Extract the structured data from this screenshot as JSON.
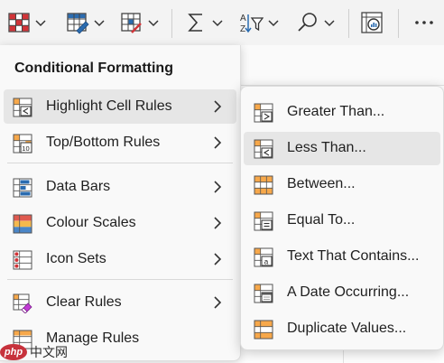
{
  "toolbar": {
    "buttons": [
      {
        "icon": "conditional-formatting-icon",
        "has_menu": true
      },
      {
        "icon": "format-as-table-icon",
        "has_menu": true
      },
      {
        "icon": "cell-styles-icon",
        "has_menu": true
      },
      {
        "icon": "autosum-icon",
        "has_menu": true
      },
      {
        "icon": "sort-filter-icon",
        "has_menu": true
      },
      {
        "icon": "find-icon",
        "has_menu": true
      },
      {
        "icon": "analyze-data-icon",
        "has_menu": false
      },
      {
        "icon": "more-options-icon",
        "has_menu": false
      }
    ]
  },
  "menu": {
    "title": "Conditional Formatting",
    "items": [
      {
        "label": "Highlight Cell Rules",
        "icon": "highlight-cell-rules-icon",
        "submenu": true,
        "active": true
      },
      {
        "label": "Top/Bottom Rules",
        "icon": "top-bottom-rules-icon",
        "submenu": true
      },
      {
        "label": "Data Bars",
        "icon": "data-bars-icon",
        "submenu": true
      },
      {
        "label": "Colour Scales",
        "icon": "colour-scales-icon",
        "submenu": true
      },
      {
        "label": "Icon Sets",
        "icon": "icon-sets-icon",
        "submenu": true
      },
      {
        "label": "Clear Rules",
        "icon": "clear-rules-icon",
        "submenu": true
      },
      {
        "label": "Manage Rules",
        "icon": "manage-rules-icon",
        "submenu": false
      }
    ]
  },
  "submenu": {
    "items": [
      {
        "label": "Greater Than...",
        "icon": "greater-than-icon"
      },
      {
        "label": "Less Than...",
        "icon": "less-than-icon",
        "active": true
      },
      {
        "label": "Between...",
        "icon": "between-icon"
      },
      {
        "label": "Equal To...",
        "icon": "equal-to-icon"
      },
      {
        "label": "Text That Contains...",
        "icon": "text-contains-icon"
      },
      {
        "label": "A Date Occurring...",
        "icon": "date-occurring-icon"
      },
      {
        "label": "Duplicate Values...",
        "icon": "duplicate-values-icon"
      }
    ]
  },
  "watermark": {
    "badge": "php",
    "text": "中文网"
  },
  "colors": {
    "accent_red": "#d13438",
    "accent_blue": "#2b6cb0",
    "highlight_orange": "#f7a84a",
    "menu_bg": "#f9f9f9",
    "hover_bg": "#e6e6e6"
  }
}
